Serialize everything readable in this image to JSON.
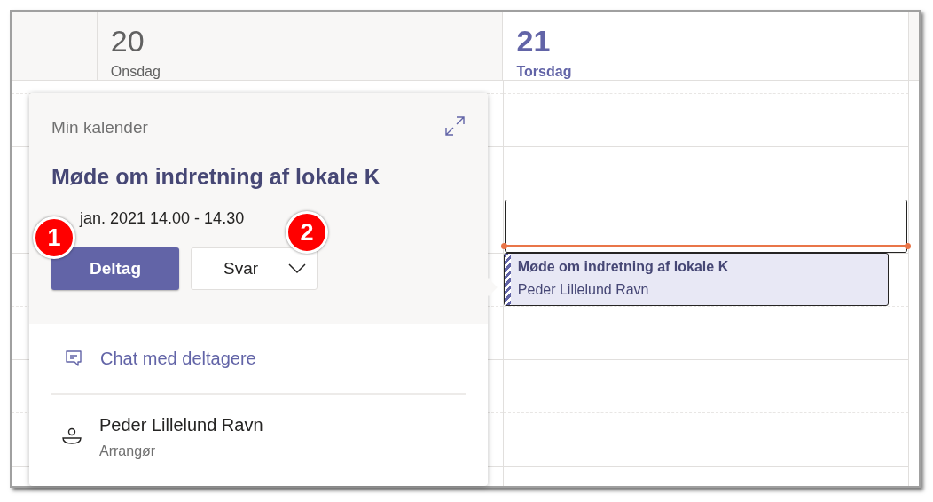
{
  "days": [
    {
      "number": "20",
      "weekday": "Onsdag",
      "selected": false
    },
    {
      "number": "21",
      "weekday": "Torsdag",
      "selected": true
    }
  ],
  "events": [
    {
      "kind": "draft"
    },
    {
      "kind": "meeting",
      "title": "Møde om indretning af lokale K",
      "organizer": "Peder Lillelund Ravn"
    }
  ],
  "popup": {
    "calendar": "Min kalender",
    "title": "Møde om indretning af lokale K",
    "datetime": "jan. 2021 14.00 - 14.30",
    "buttons": [
      {
        "label": "Deltag",
        "kind": "primary"
      },
      {
        "label": "Svar",
        "kind": "dropdown"
      }
    ],
    "chat_link": "Chat med deltagere",
    "organizer": {
      "name": "Peder Lillelund Ravn",
      "role": "Arrangør"
    }
  },
  "callouts": [
    "1",
    "2"
  ]
}
